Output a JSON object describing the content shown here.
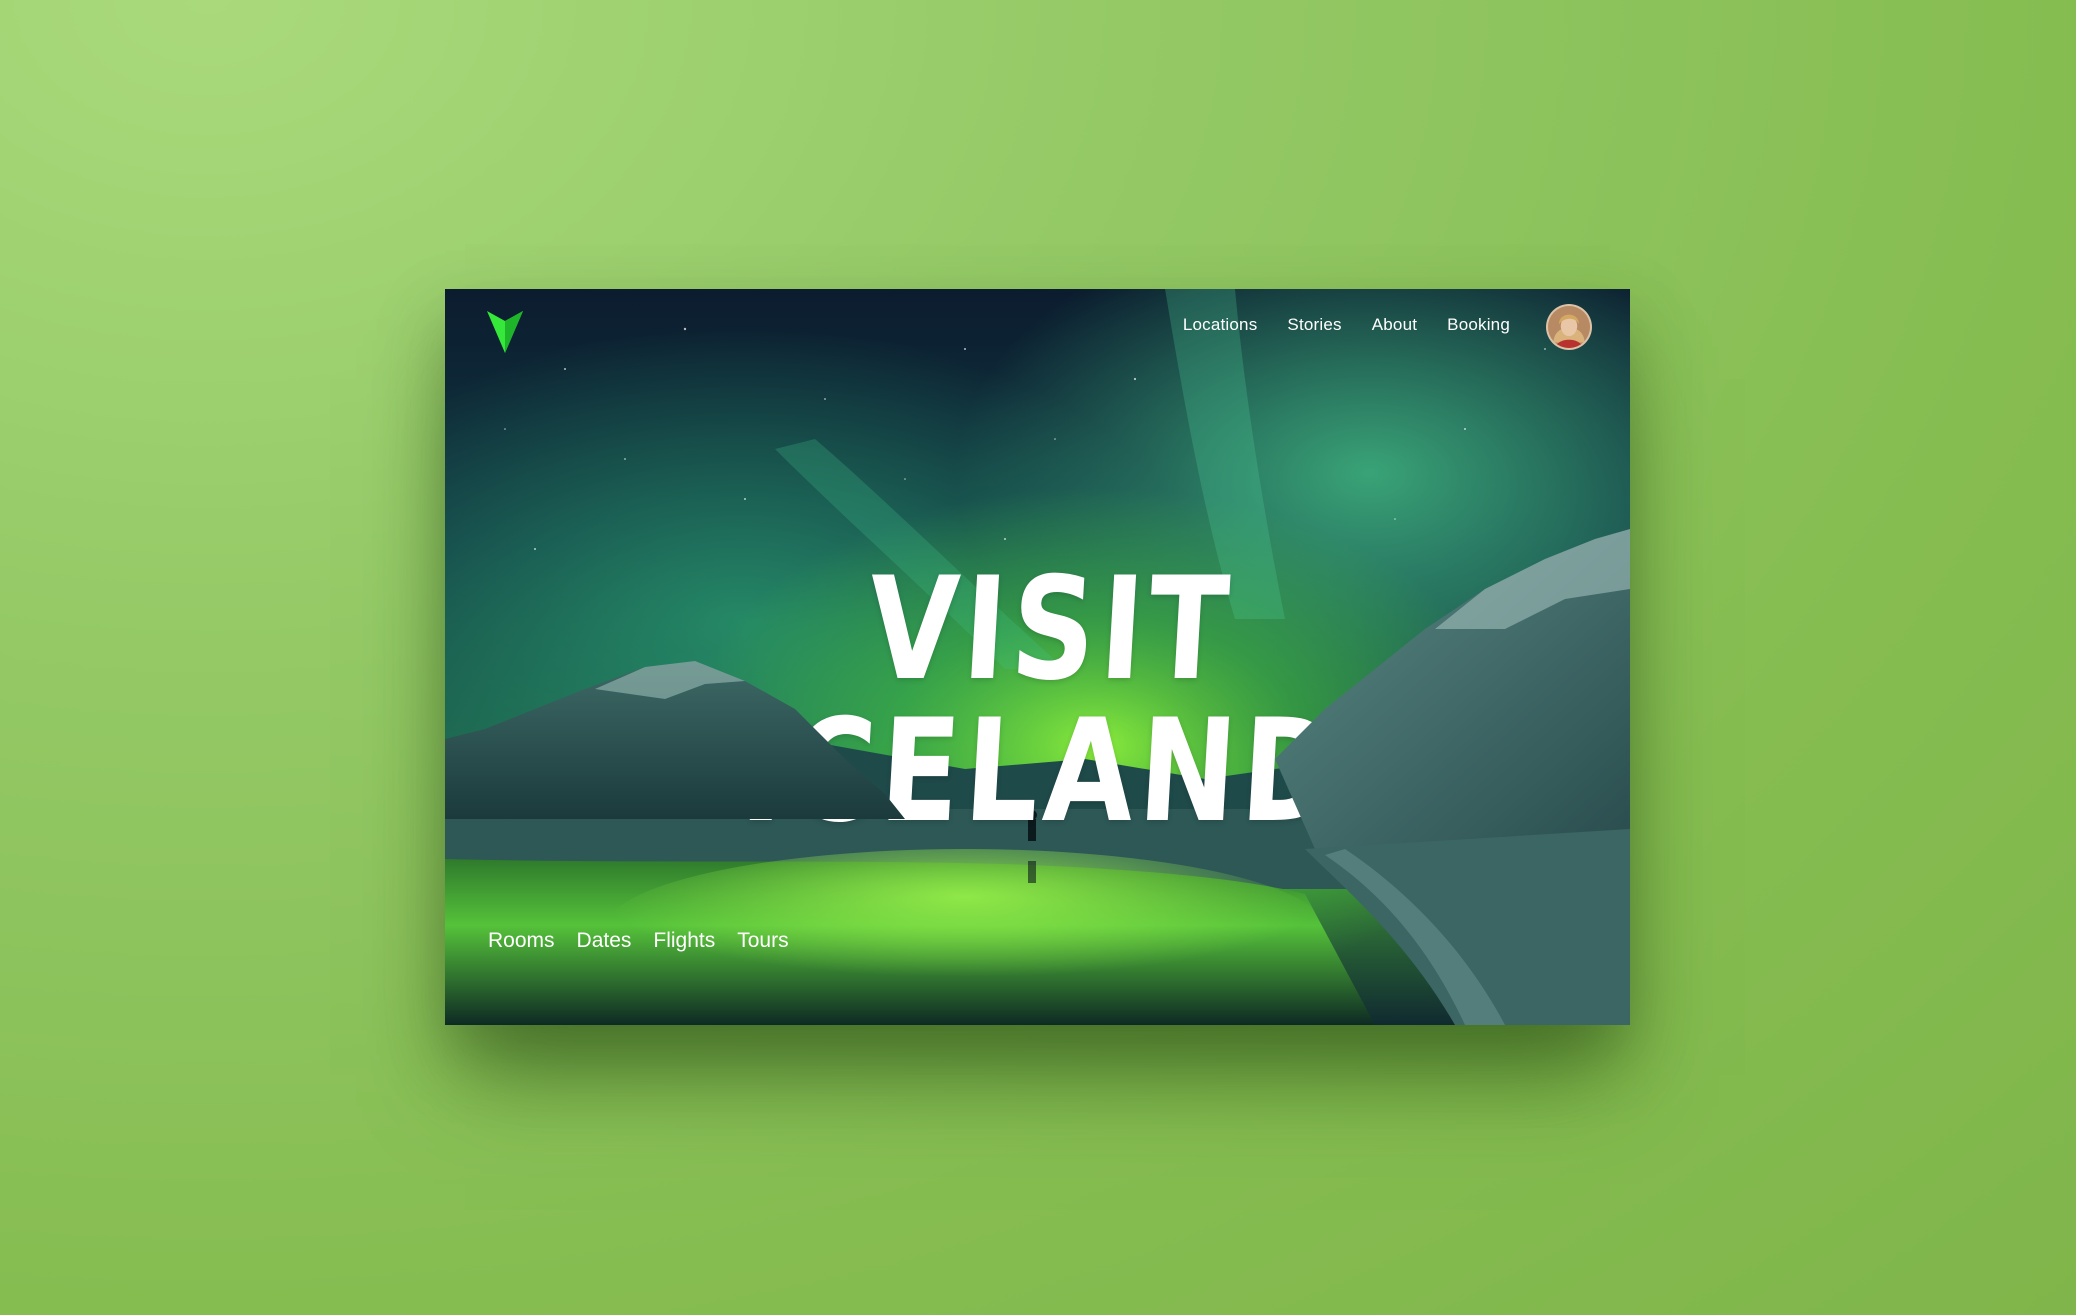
{
  "brand": {
    "logo_icon": "v-arrow-logo-icon",
    "accent": "#3ef03a"
  },
  "nav": {
    "items": [
      {
        "label": "Locations"
      },
      {
        "label": "Stories"
      },
      {
        "label": "About"
      },
      {
        "label": "Booking"
      }
    ]
  },
  "user": {
    "avatar_icon": "user-avatar"
  },
  "hero": {
    "headline": "VISIT ICELAND"
  },
  "subnav": {
    "items": [
      {
        "label": "Rooms"
      },
      {
        "label": "Dates"
      },
      {
        "label": "Flights"
      },
      {
        "label": "Tours"
      }
    ]
  },
  "colors": {
    "page_background": "#8ec45c",
    "aurora": "#5be04a",
    "sky": "#0c2434",
    "text": "#ffffff"
  }
}
